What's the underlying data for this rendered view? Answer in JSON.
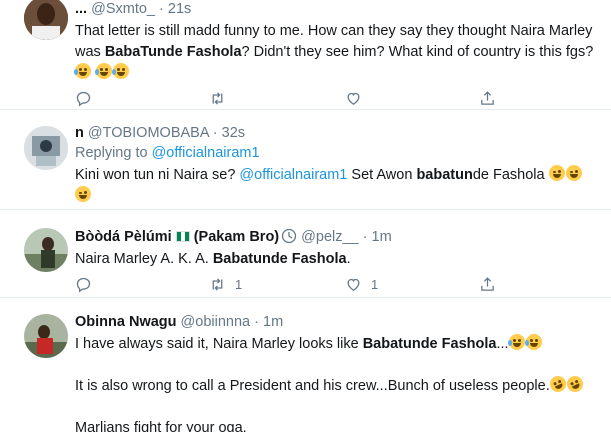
{
  "tweets": [
    {
      "name": "...",
      "handle": "@Sxmto_",
      "time": "21s",
      "text_parts": [
        "That letter is still madd funny to me. How can they say they thought Naira Marley was ",
        "BabaTunde Fashola",
        "? Didn't they see him? What kind of country is this fgs?"
      ],
      "emojis": [
        "face-with-tears-of-joy",
        "face-with-tears-of-joy",
        "face-with-tears-of-joy"
      ],
      "reply_count": "",
      "retweet_count": "",
      "like_count": ""
    },
    {
      "name": "n",
      "handle": "@TOBIOMOBABA",
      "time": "32s",
      "replying_label": "Replying to",
      "replying_to": "@officialnairam1",
      "text_parts": [
        "Kini won tun ni Naira se? ",
        "@officialnairam1",
        " Set Awon ",
        "babatun",
        "de Fashola "
      ],
      "emojis": [
        "zany-face",
        "zany-face",
        "zany-face"
      ]
    },
    {
      "name": "Bòòdá Pèlúmi",
      "name_suffix": "(Pakam Bro)",
      "handle": "@pelz__",
      "time": "1m",
      "text_parts": [
        "Naira Marley A. K. A. ",
        "Babatunde Fashola",
        "."
      ],
      "retweet_count": "1",
      "like_count": "1"
    },
    {
      "name": "Obinna Nwagu",
      "handle": "@obiinnna",
      "time": "1m",
      "line1_parts": [
        "I have always said it, Naira Marley looks like ",
        "Babatunde Fashola",
        "..."
      ],
      "line2": "It is also wrong to call a President and his crew...Bunch of useless people.",
      "line3": "Marlians fight for your oga."
    }
  ],
  "separator": "·",
  "colors": {
    "link": "#1b95e0",
    "muted": "#657786",
    "divider": "#e6ecf0"
  }
}
